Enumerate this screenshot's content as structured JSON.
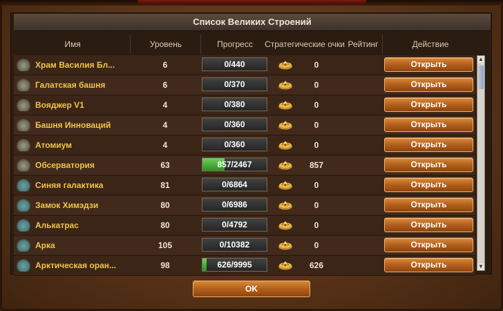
{
  "window": {
    "title": "Список Великих Строений"
  },
  "columns": {
    "name": "Имя",
    "level": "Уровень",
    "progress": "Прогресс",
    "strategy": "Стратегические очки",
    "rating": "Рейтинг",
    "action": "Действие"
  },
  "rows": [
    {
      "name": "Храм Василия Бл...",
      "level": "6",
      "progress": "0/440",
      "progress_fraction": 0,
      "points": "0",
      "action": "Открыть"
    },
    {
      "name": "Галатская башня",
      "level": "6",
      "progress": "0/370",
      "progress_fraction": 0,
      "points": "0",
      "action": "Открыть"
    },
    {
      "name": "Вояджер V1",
      "level": "4",
      "progress": "0/380",
      "progress_fraction": 0,
      "points": "0",
      "action": "Открыть"
    },
    {
      "name": "Башня Инноваций",
      "level": "4",
      "progress": "0/360",
      "progress_fraction": 0,
      "points": "0",
      "action": "Открыть"
    },
    {
      "name": "Атомиум",
      "level": "4",
      "progress": "0/360",
      "progress_fraction": 0,
      "points": "0",
      "action": "Открыть"
    },
    {
      "name": "Обсерватория",
      "level": "63",
      "progress": "857/2467",
      "progress_fraction": 0.347,
      "points": "857",
      "action": "Открыть"
    },
    {
      "name": "Синяя галактика",
      "level": "81",
      "progress": "0/6864",
      "progress_fraction": 0,
      "points": "0",
      "action": "Открыть"
    },
    {
      "name": "Замок Химэдзи",
      "level": "80",
      "progress": "0/6986",
      "progress_fraction": 0,
      "points": "0",
      "action": "Открыть"
    },
    {
      "name": "Алькатрас",
      "level": "80",
      "progress": "0/4792",
      "progress_fraction": 0,
      "points": "0",
      "action": "Открыть"
    },
    {
      "name": "Арка",
      "level": "105",
      "progress": "0/10382",
      "progress_fraction": 0,
      "points": "0",
      "action": "Открыть"
    },
    {
      "name": "Арктическая оран...",
      "level": "98",
      "progress": "626/9995",
      "progress_fraction": 0.063,
      "points": "626",
      "action": "Открыть"
    }
  ],
  "footer": {
    "ok_label": "OK"
  },
  "icons": {
    "building": "building-icon",
    "strategy": "strategy-points-icon"
  }
}
